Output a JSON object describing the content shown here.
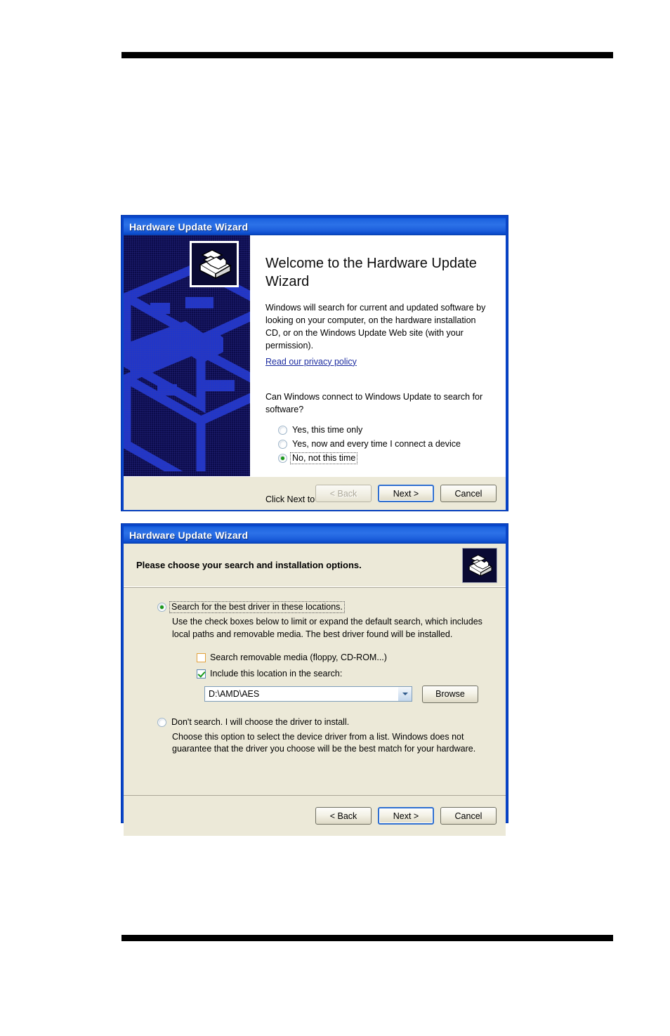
{
  "page": {
    "background_color": "#FFFFFF",
    "rule_color": "#000000"
  },
  "dialog_welcome": {
    "titlebar": {
      "title": "Hardware Update Wizard"
    },
    "heading": "Welcome to the Hardware Update Wizard",
    "intro": "Windows will search for current and updated software by looking on your computer, on the hardware installation CD, or on the Windows Update Web site (with your permission).",
    "privacy_link": "Read our privacy policy",
    "question": "Can Windows connect to Windows Update to search for software?",
    "options": [
      {
        "label": "Yes, this time only",
        "selected": false,
        "focused": false
      },
      {
        "label": "Yes, now and every time I connect a device",
        "selected": false,
        "focused": false
      },
      {
        "label": "No, not this time",
        "selected": true,
        "focused": true
      }
    ],
    "footer_hint": "Click Next to continue.",
    "buttons": {
      "back": "< Back",
      "back_enabled": false,
      "next": "Next >",
      "next_default": true,
      "cancel": "Cancel"
    },
    "sidebar": {
      "background_color": "#0B0B4A",
      "watermark_color": "#2036C8",
      "icon_name": "hardware-device-icon"
    }
  },
  "dialog_options": {
    "titlebar": {
      "title": "Hardware Update Wizard"
    },
    "header_title": "Please choose your search and installation options.",
    "header_icon_name": "hardware-device-icon",
    "search_option": {
      "label": "Search for the best driver in these locations.",
      "selected": true,
      "focused": true,
      "description": "Use the check boxes below to limit or expand the default search, which includes local paths and removable media. The best driver found will be installed."
    },
    "checkboxes": [
      {
        "label": "Search removable media (floppy, CD-ROM...)",
        "checked": false,
        "border_color": "#E3A23C"
      },
      {
        "label": "Include this location in the search:",
        "checked": true,
        "border_color": "#5C87B2"
      }
    ],
    "location": {
      "value": "D:\\AMD\\AES",
      "placeholder": "",
      "browse_label": "Browse"
    },
    "manual_option": {
      "label": "Don't search. I will choose the driver to install.",
      "selected": false,
      "description": "Choose this option to select the device driver from a list.  Windows does not guarantee that the driver you choose will be the best match for your hardware."
    },
    "buttons": {
      "back": "< Back",
      "back_enabled": true,
      "next": "Next >",
      "next_default": true,
      "cancel": "Cancel"
    }
  }
}
